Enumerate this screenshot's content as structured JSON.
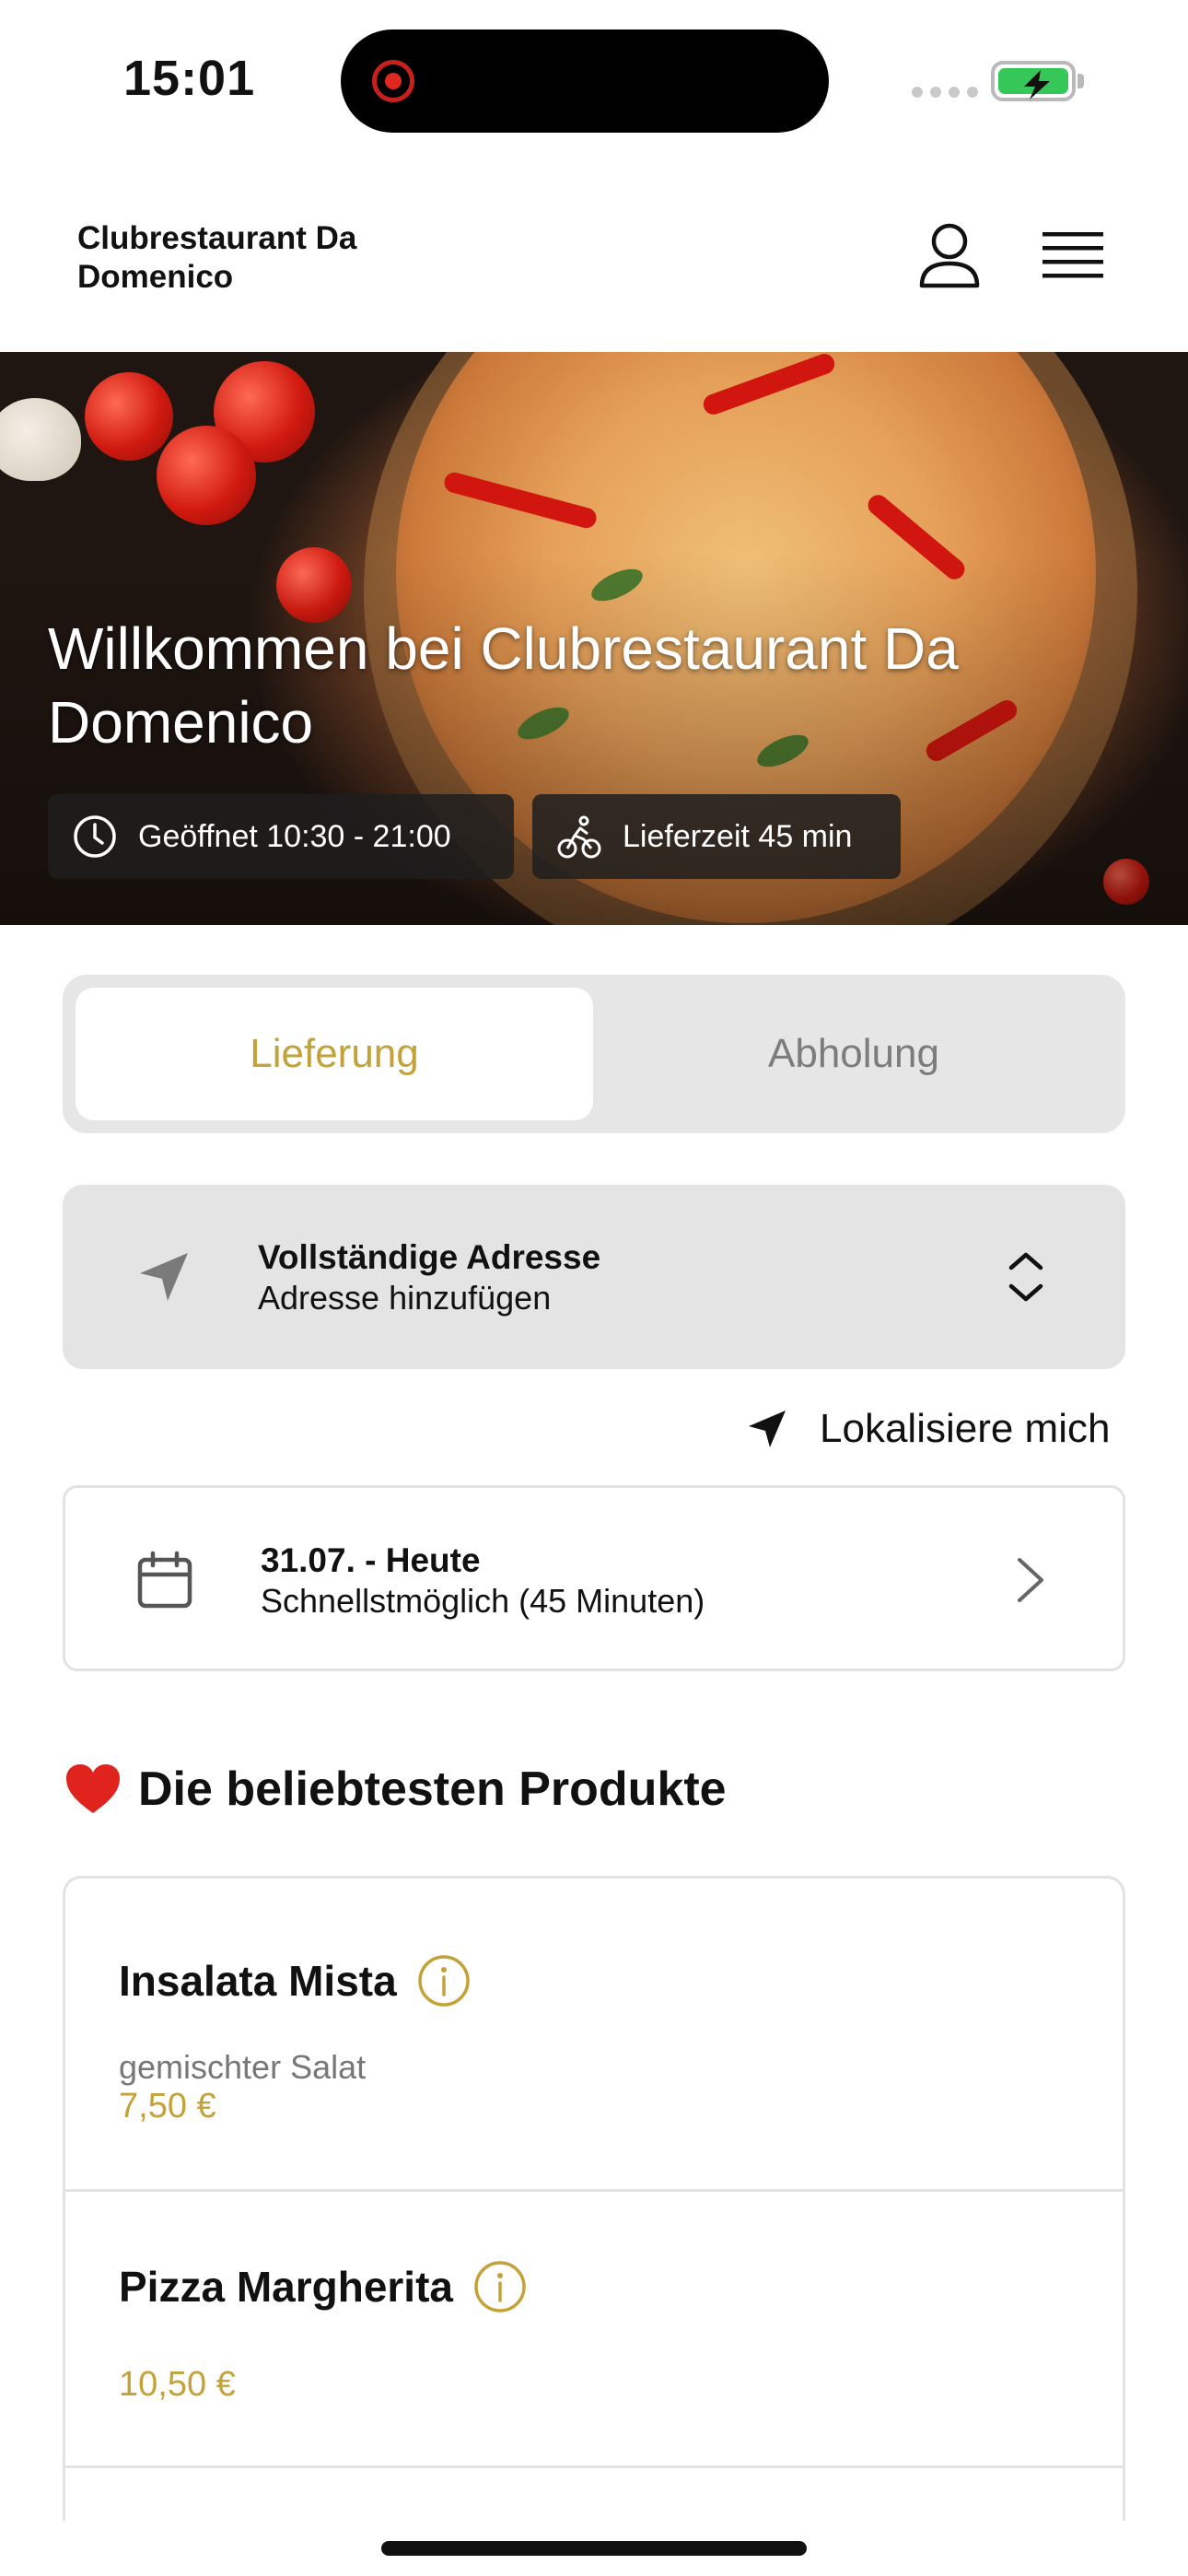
{
  "status_bar": {
    "time": "15:01"
  },
  "header": {
    "brand": "Clubrestaurant Da Domenico",
    "icons": [
      "user-icon",
      "menu-icon"
    ]
  },
  "hero": {
    "title": "Willkommen bei Clubrestaurant Da Domenico",
    "opening_hours": "Geöffnet 10:30 - 21:00",
    "delivery_time": "Lieferzeit 45 min"
  },
  "order_mode": {
    "options": [
      "Lieferung",
      "Abholung"
    ],
    "selected": "Lieferung"
  },
  "address": {
    "title": "Vollständige Adresse",
    "subtitle": "Adresse hinzufügen"
  },
  "locate": {
    "label": "Lokalisiere mich"
  },
  "schedule": {
    "title": "31.07. - Heute",
    "subtitle": "Schnellstmöglich (45 Minuten)"
  },
  "popular": {
    "title": "Die beliebtesten Produkte",
    "products": [
      {
        "name": "Insalata Mista",
        "description": "gemischter Salat",
        "price": "7,50 €"
      },
      {
        "name": "Pizza Margherita",
        "description": "",
        "price": "10,50 €"
      }
    ]
  },
  "colors": {
    "accent": "#C4A23A",
    "card_grey": "#E4E4E4",
    "battery_green": "#36C759"
  }
}
